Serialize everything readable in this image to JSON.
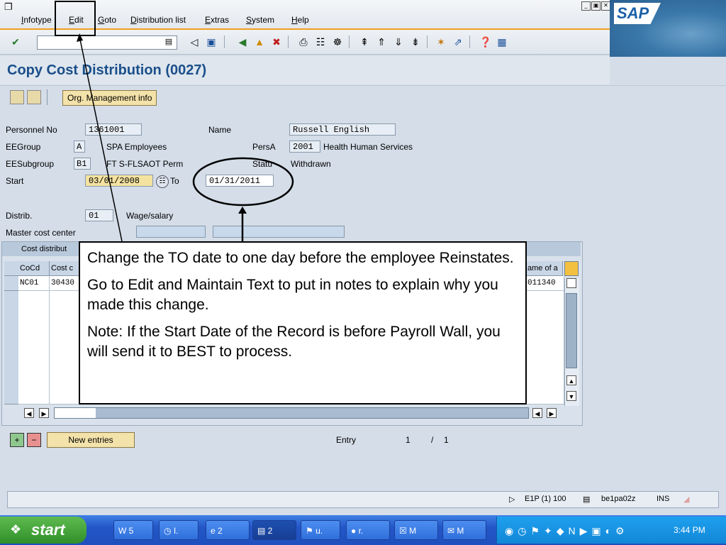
{
  "menu": {
    "items": [
      "Infotype",
      "Edit",
      "Goto",
      "Distribution list",
      "Extras",
      "System",
      "Help"
    ]
  },
  "brand": {
    "logo_text": "SAP"
  },
  "page": {
    "title": "Copy Cost Distribution (0027)"
  },
  "app_toolbar": {
    "org_button": "Org. Management info"
  },
  "form": {
    "personnel_no_label": "Personnel No",
    "personnel_no": "1361001",
    "name_label": "Name",
    "name": "Russell English",
    "eegroup_label": "EEGroup",
    "eegroup": "A",
    "eegroup_text": "SPA Employees",
    "persa_label": "PersA",
    "persa": "2001",
    "persa_text": "Health Human Services",
    "eesubgroup_label": "EESubgroup",
    "eesubgroup": "B1",
    "eesubgroup_text": "FT S-FLSAOT Perm",
    "status_label": "Statu",
    "status_text": "Withdrawn",
    "start_label": "Start",
    "start": "03/01/2008",
    "to_label": "To",
    "to": "01/31/2011",
    "distrib_label": "Distrib.",
    "distrib": "01",
    "distrib_text": "Wage/salary",
    "master_cc_label": "Master cost center"
  },
  "table": {
    "caption": "Cost distribut",
    "headers": [
      "CoCd",
      "Cost c",
      "ame of a"
    ],
    "rows": [
      [
        "NC01",
        "30430",
        "011340"
      ]
    ]
  },
  "annotation": {
    "p1": "Change the TO date to one day before the employee Reinstates.",
    "p2": "Go to Edit and Maintain Text to put in notes to explain why you made this change.",
    "p3": "Note:  If the Start Date of the Record is before Payroll Wall, you will send it to BEST to process."
  },
  "bottom": {
    "new_entries": "New entries",
    "entry_label": "Entry",
    "entry_current": "1",
    "entry_sep": "/",
    "entry_total": "1"
  },
  "status": {
    "system": "E1P (1) 100",
    "server": "be1pa02z",
    "mode": "INS"
  },
  "taskbar": {
    "start": "start",
    "tasks": [
      "5",
      "I.",
      "2",
      "2",
      "u.",
      "r.",
      "M",
      "M"
    ],
    "clock": "3:44 PM"
  },
  "colors": {
    "title_blue": "#1a4f8a",
    "accent_orange": "#f0a020",
    "button_yellow": "#f3e2a9"
  }
}
